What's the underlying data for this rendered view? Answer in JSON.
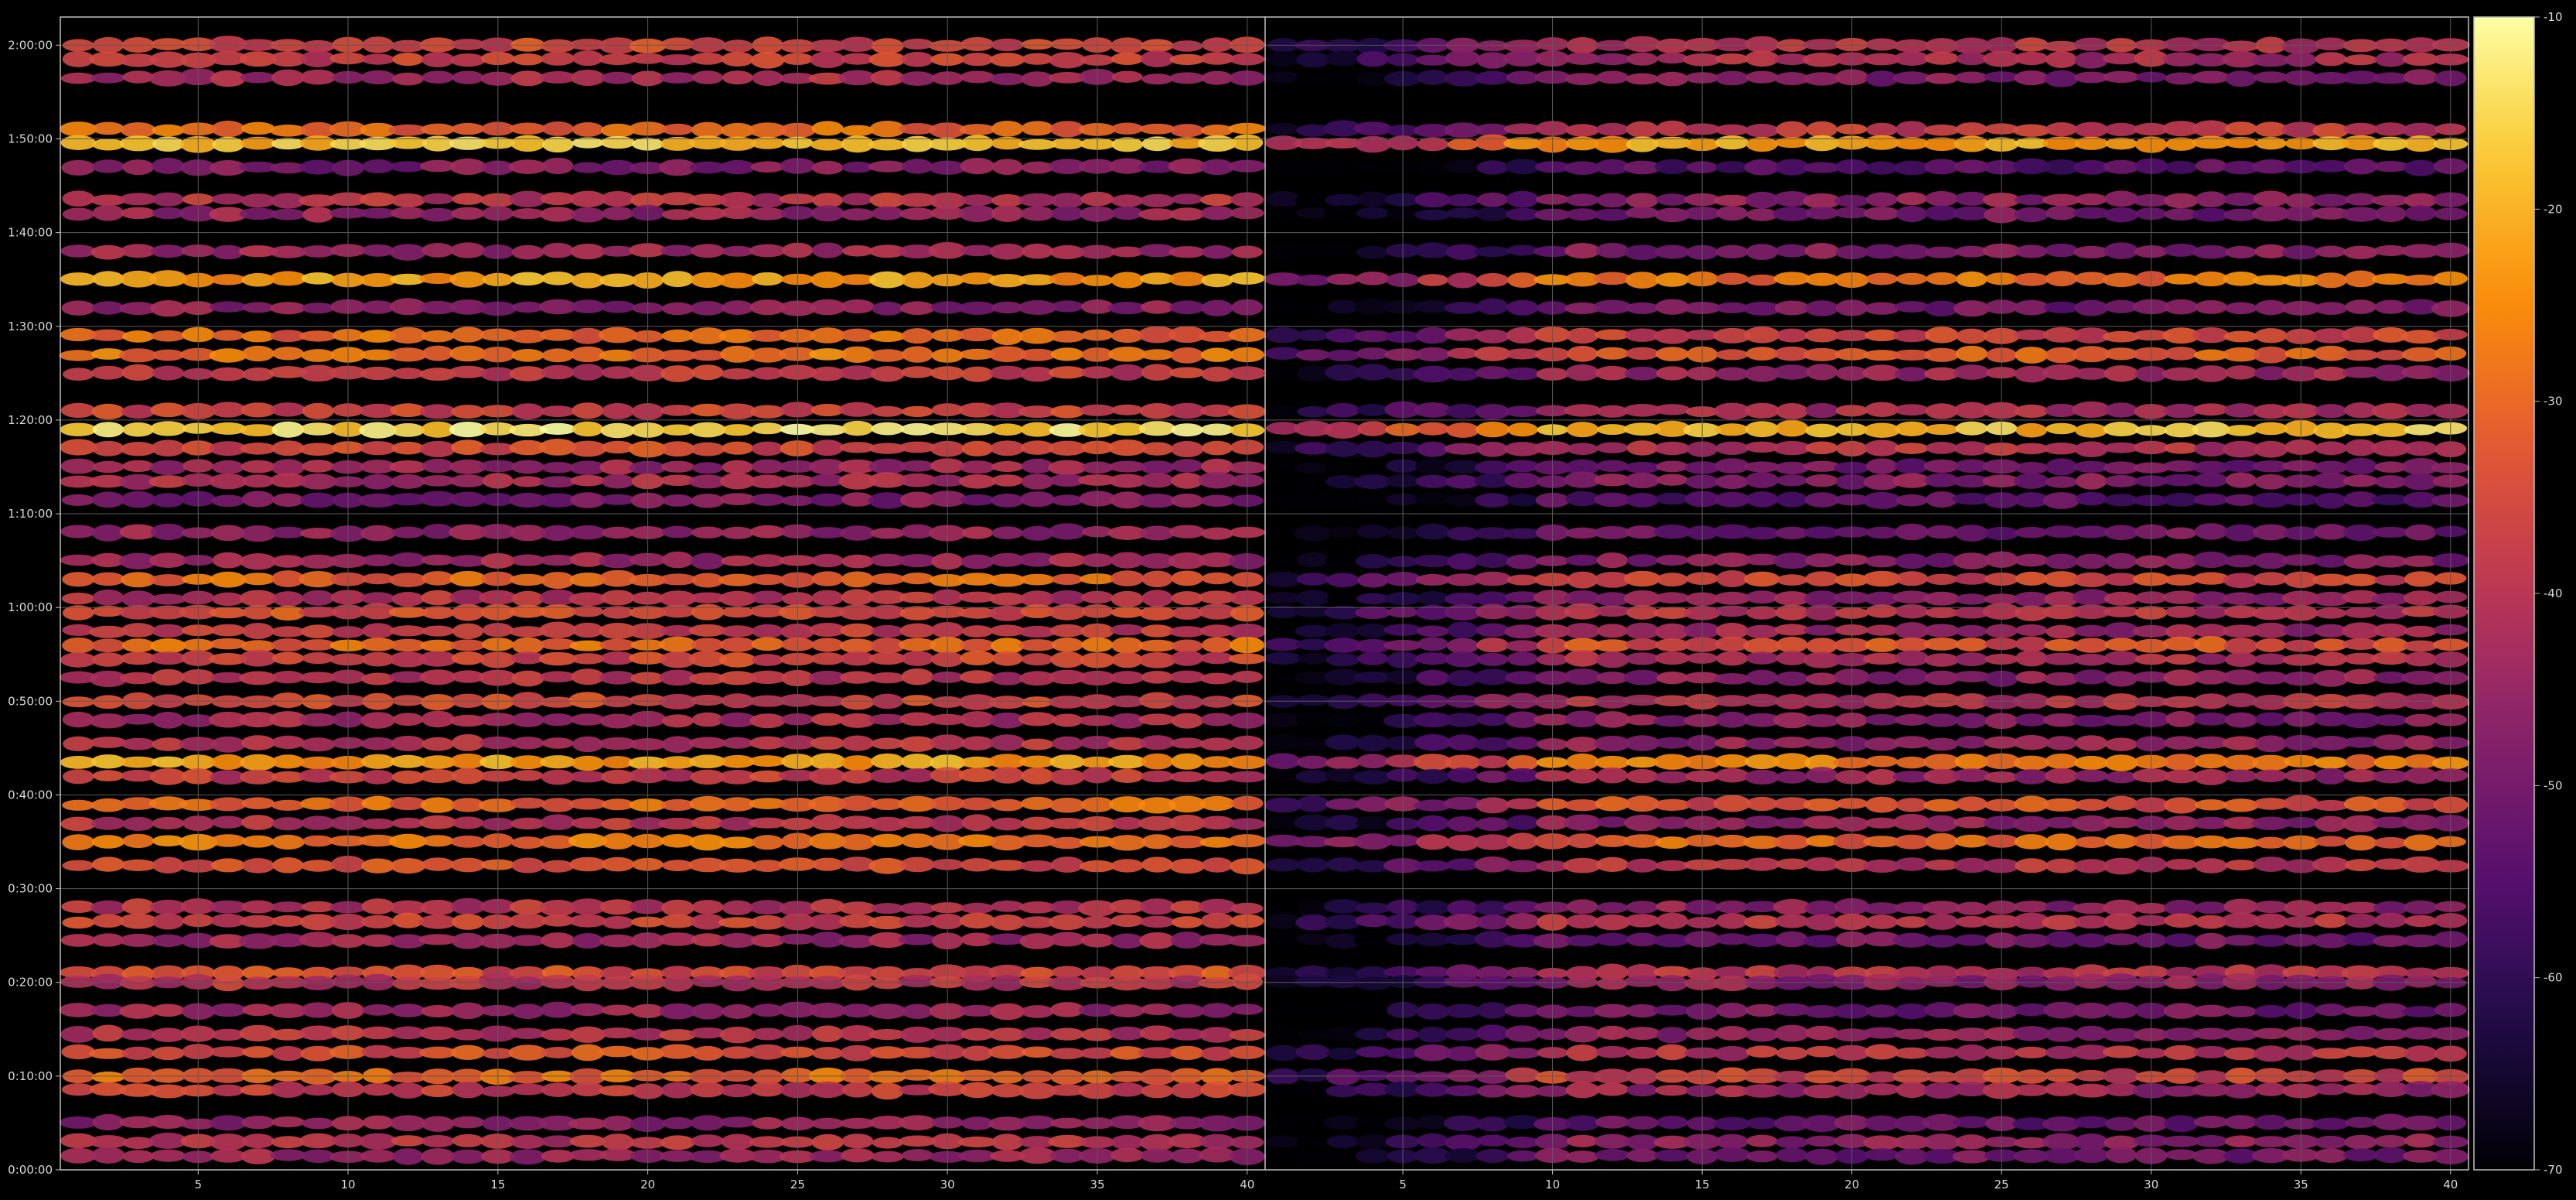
{
  "chart_data": [
    {
      "type": "heatmap",
      "title": "",
      "xlabel": "",
      "ylabel": "",
      "x_range": [
        1,
        40
      ],
      "x_ticks": [
        5,
        10,
        15,
        20,
        25,
        30,
        35,
        40
      ],
      "y_range_seconds": [
        0,
        7380
      ],
      "y_ticks": [
        "0:00:00",
        "0:10:00",
        "0:20:00",
        "0:30:00",
        "0:40:00",
        "0:50:00",
        "1:00:00",
        "1:10:00",
        "1:20:00",
        "1:30:00",
        "1:40:00",
        "1:50:00",
        "2:00:00"
      ],
      "grid": true,
      "bands": [
        {
          "t": "2:00:00",
          "v": -35
        },
        {
          "t": "1:58:30",
          "v": -37
        },
        {
          "t": "1:56:30",
          "v": -42
        },
        {
          "t": "1:51:00",
          "v": -30
        },
        {
          "t": "1:49:30",
          "v": -18
        },
        {
          "t": "1:47:00",
          "v": -48
        },
        {
          "t": "1:43:30",
          "v": -40
        },
        {
          "t": "1:42:00",
          "v": -45
        },
        {
          "t": "1:38:00",
          "v": -44
        },
        {
          "t": "1:35:00",
          "v": -22
        },
        {
          "t": "1:32:00",
          "v": -46
        },
        {
          "t": "1:29:00",
          "v": -30
        },
        {
          "t": "1:27:00",
          "v": -28
        },
        {
          "t": "1:25:00",
          "v": -38
        },
        {
          "t": "1:21:00",
          "v": -36
        },
        {
          "t": "1:19:00",
          "v": -14
        },
        {
          "t": "1:17:00",
          "v": -35
        },
        {
          "t": "1:15:00",
          "v": -44
        },
        {
          "t": "1:13:30",
          "v": -42
        },
        {
          "t": "1:11:30",
          "v": -48
        },
        {
          "t": "1:08:00",
          "v": -45
        },
        {
          "t": "1:05:00",
          "v": -44
        },
        {
          "t": "1:03:00",
          "v": -30
        },
        {
          "t": "1:01:00",
          "v": -40
        },
        {
          "t": "0:59:30",
          "v": -34
        },
        {
          "t": "0:57:30",
          "v": -38
        },
        {
          "t": "0:56:00",
          "v": -30
        },
        {
          "t": "0:54:30",
          "v": -36
        },
        {
          "t": "0:52:30",
          "v": -40
        },
        {
          "t": "0:50:00",
          "v": -36
        },
        {
          "t": "0:48:00",
          "v": -42
        },
        {
          "t": "0:45:30",
          "v": -40
        },
        {
          "t": "0:43:30",
          "v": -22
        },
        {
          "t": "0:42:00",
          "v": -38
        },
        {
          "t": "0:39:00",
          "v": -30
        },
        {
          "t": "0:37:00",
          "v": -40
        },
        {
          "t": "0:35:00",
          "v": -28
        },
        {
          "t": "0:32:30",
          "v": -34
        },
        {
          "t": "0:28:00",
          "v": -40
        },
        {
          "t": "0:26:30",
          "v": -36
        },
        {
          "t": "0:24:30",
          "v": -44
        },
        {
          "t": "0:21:00",
          "v": -34
        },
        {
          "t": "0:20:00",
          "v": -40
        },
        {
          "t": "0:17:00",
          "v": -44
        },
        {
          "t": "0:14:30",
          "v": -40
        },
        {
          "t": "0:12:30",
          "v": -34
        },
        {
          "t": "0:10:00",
          "v": -30
        },
        {
          "t": "0:08:30",
          "v": -38
        },
        {
          "t": "0:05:00",
          "v": -46
        },
        {
          "t": "0:03:00",
          "v": -40
        },
        {
          "t": "0:01:30",
          "v": -44
        }
      ]
    },
    {
      "type": "heatmap",
      "title": "",
      "xlabel": "",
      "ylabel": "",
      "x_range": [
        1,
        40
      ],
      "x_ticks": [
        5,
        10,
        15,
        20,
        25,
        30,
        35,
        40
      ],
      "y_range_seconds": [
        0,
        7380
      ],
      "grid": true,
      "bands": [
        {
          "t": "2:00:00",
          "v": -40
        },
        {
          "t": "1:58:30",
          "v": -42
        },
        {
          "t": "1:56:30",
          "v": -48
        },
        {
          "t": "1:51:00",
          "v": -38
        },
        {
          "t": "1:49:30",
          "v": -22
        },
        {
          "t": "1:47:00",
          "v": -54
        },
        {
          "t": "1:43:30",
          "v": -46
        },
        {
          "t": "1:42:00",
          "v": -50
        },
        {
          "t": "1:38:00",
          "v": -48
        },
        {
          "t": "1:35:00",
          "v": -28
        },
        {
          "t": "1:32:00",
          "v": -50
        },
        {
          "t": "1:29:00",
          "v": -36
        },
        {
          "t": "1:27:00",
          "v": -32
        },
        {
          "t": "1:25:00",
          "v": -44
        },
        {
          "t": "1:21:00",
          "v": -42
        },
        {
          "t": "1:19:00",
          "v": -18
        },
        {
          "t": "1:17:00",
          "v": -40
        },
        {
          "t": "1:15:00",
          "v": -50
        },
        {
          "t": "1:13:30",
          "v": -48
        },
        {
          "t": "1:11:30",
          "v": -54
        },
        {
          "t": "1:08:00",
          "v": -50
        },
        {
          "t": "1:05:00",
          "v": -48
        },
        {
          "t": "1:03:00",
          "v": -36
        },
        {
          "t": "1:01:00",
          "v": -46
        },
        {
          "t": "0:59:30",
          "v": -40
        },
        {
          "t": "0:57:30",
          "v": -44
        },
        {
          "t": "0:56:00",
          "v": -34
        },
        {
          "t": "0:54:30",
          "v": -42
        },
        {
          "t": "0:52:30",
          "v": -46
        },
        {
          "t": "0:50:00",
          "v": -40
        },
        {
          "t": "0:48:00",
          "v": -48
        },
        {
          "t": "0:45:30",
          "v": -46
        },
        {
          "t": "0:43:30",
          "v": -26
        },
        {
          "t": "0:42:00",
          "v": -44
        },
        {
          "t": "0:39:00",
          "v": -34
        },
        {
          "t": "0:37:00",
          "v": -46
        },
        {
          "t": "0:35:00",
          "v": -30
        },
        {
          "t": "0:32:30",
          "v": -40
        },
        {
          "t": "0:28:00",
          "v": -46
        },
        {
          "t": "0:26:30",
          "v": -40
        },
        {
          "t": "0:24:30",
          "v": -50
        },
        {
          "t": "0:21:00",
          "v": -40
        },
        {
          "t": "0:20:00",
          "v": -46
        },
        {
          "t": "0:17:00",
          "v": -50
        },
        {
          "t": "0:14:30",
          "v": -46
        },
        {
          "t": "0:12:30",
          "v": -40
        },
        {
          "t": "0:10:00",
          "v": -36
        },
        {
          "t": "0:08:30",
          "v": -44
        },
        {
          "t": "0:05:00",
          "v": -52
        },
        {
          "t": "0:03:00",
          "v": -46
        },
        {
          "t": "0:01:30",
          "v": -50
        }
      ]
    }
  ],
  "colorbar": {
    "colormap": "inferno",
    "range": [
      -70,
      -10
    ],
    "ticks": [
      "-10",
      "-20",
      "-30",
      "-40",
      "-50",
      "-60",
      "-70"
    ]
  },
  "colors": {
    "background": "#000000",
    "grid": "#5a5a5a",
    "spine": "#bfbfbf",
    "text": "#d8d8d8"
  }
}
